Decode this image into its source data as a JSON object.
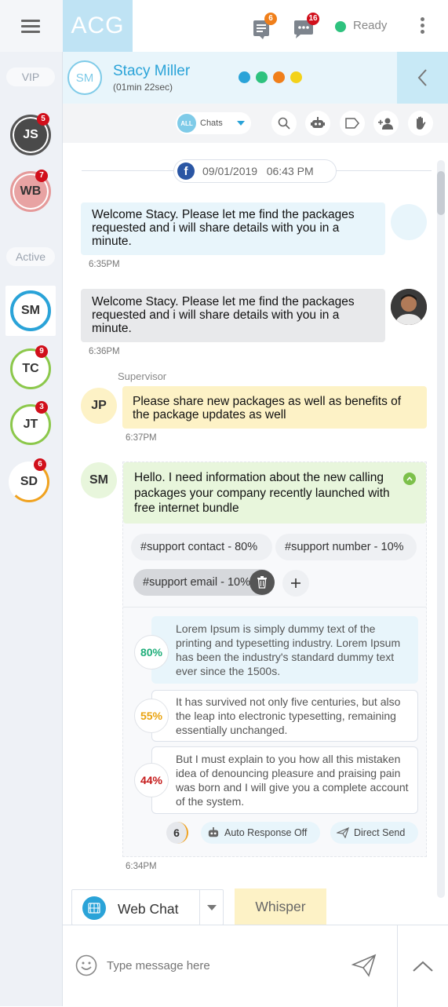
{
  "app": {
    "logo": "ACG",
    "status": "Ready",
    "notif_count": "6",
    "msg_count": "16"
  },
  "rail": {
    "vip_label": "VIP",
    "active_label": "Active",
    "vip_contacts": [
      {
        "initials": "JS",
        "badge": "5"
      },
      {
        "initials": "WB",
        "badge": "7"
      }
    ],
    "active_contacts": [
      {
        "initials": "SM",
        "badge": ""
      },
      {
        "initials": "TC",
        "badge": "9"
      },
      {
        "initials": "JT",
        "badge": "3"
      },
      {
        "initials": "SD",
        "badge": "6"
      }
    ]
  },
  "contact": {
    "initials": "SM",
    "name": "Stacy Miller",
    "duration": "(01min 22sec)"
  },
  "toolbar": {
    "filter_badge": "ALL",
    "filter_label": "Chats"
  },
  "chat": {
    "date_stamp": "09/01/2019   06:43 PM",
    "messages": [
      {
        "text": "Welcome Stacy. Please let me find the packages requested and i will share details with you in a minute.",
        "time": "6:35PM"
      },
      {
        "text": "Welcome Stacy. Please let me find the packages requested and i will share details with you in a minute.",
        "time": "6:36PM"
      }
    ],
    "supervisor": {
      "label": "Supervisor",
      "initials": "JP",
      "text": "Please share new packages as well as benefits of the package updates as well",
      "time": "6:37PM"
    },
    "customer": {
      "initials": "SM",
      "text": "Hello. I need information about the new calling packages your company recently launched with free internet bundle",
      "tags": [
        "#support contact - 80%",
        "#support number - 10%",
        "#support email - 10%"
      ],
      "suggestions": [
        {
          "pct": "80%",
          "text": "Lorem Ipsum is simply dummy text of the printing and typesetting industry. Lorem Ipsum has been the industry's standard dummy text ever since the 1500s."
        },
        {
          "pct": "55%",
          "text": "It has survived not only five centuries, but also the leap into electronic typesetting, remaining essentially unchanged."
        },
        {
          "pct": "44%",
          "text": "But I must explain to you how all this mistaken idea of denouncing pleasure and praising pain was born and I will give you a complete account of the system."
        }
      ],
      "count": "6",
      "auto_response": "Auto Response Off",
      "direct_send": "Direct Send",
      "time": "6:34PM"
    }
  },
  "channel": {
    "label": "Web Chat",
    "whisper": "Whisper"
  },
  "composer": {
    "placeholder": "Type message here"
  },
  "colors": {
    "accent": "#2aa3d8",
    "ready": "#2ec27e",
    "badge": "#d10f1b",
    "supervisor_bg": "#fdf2c6",
    "customer_bg": "#e8f6dc"
  }
}
